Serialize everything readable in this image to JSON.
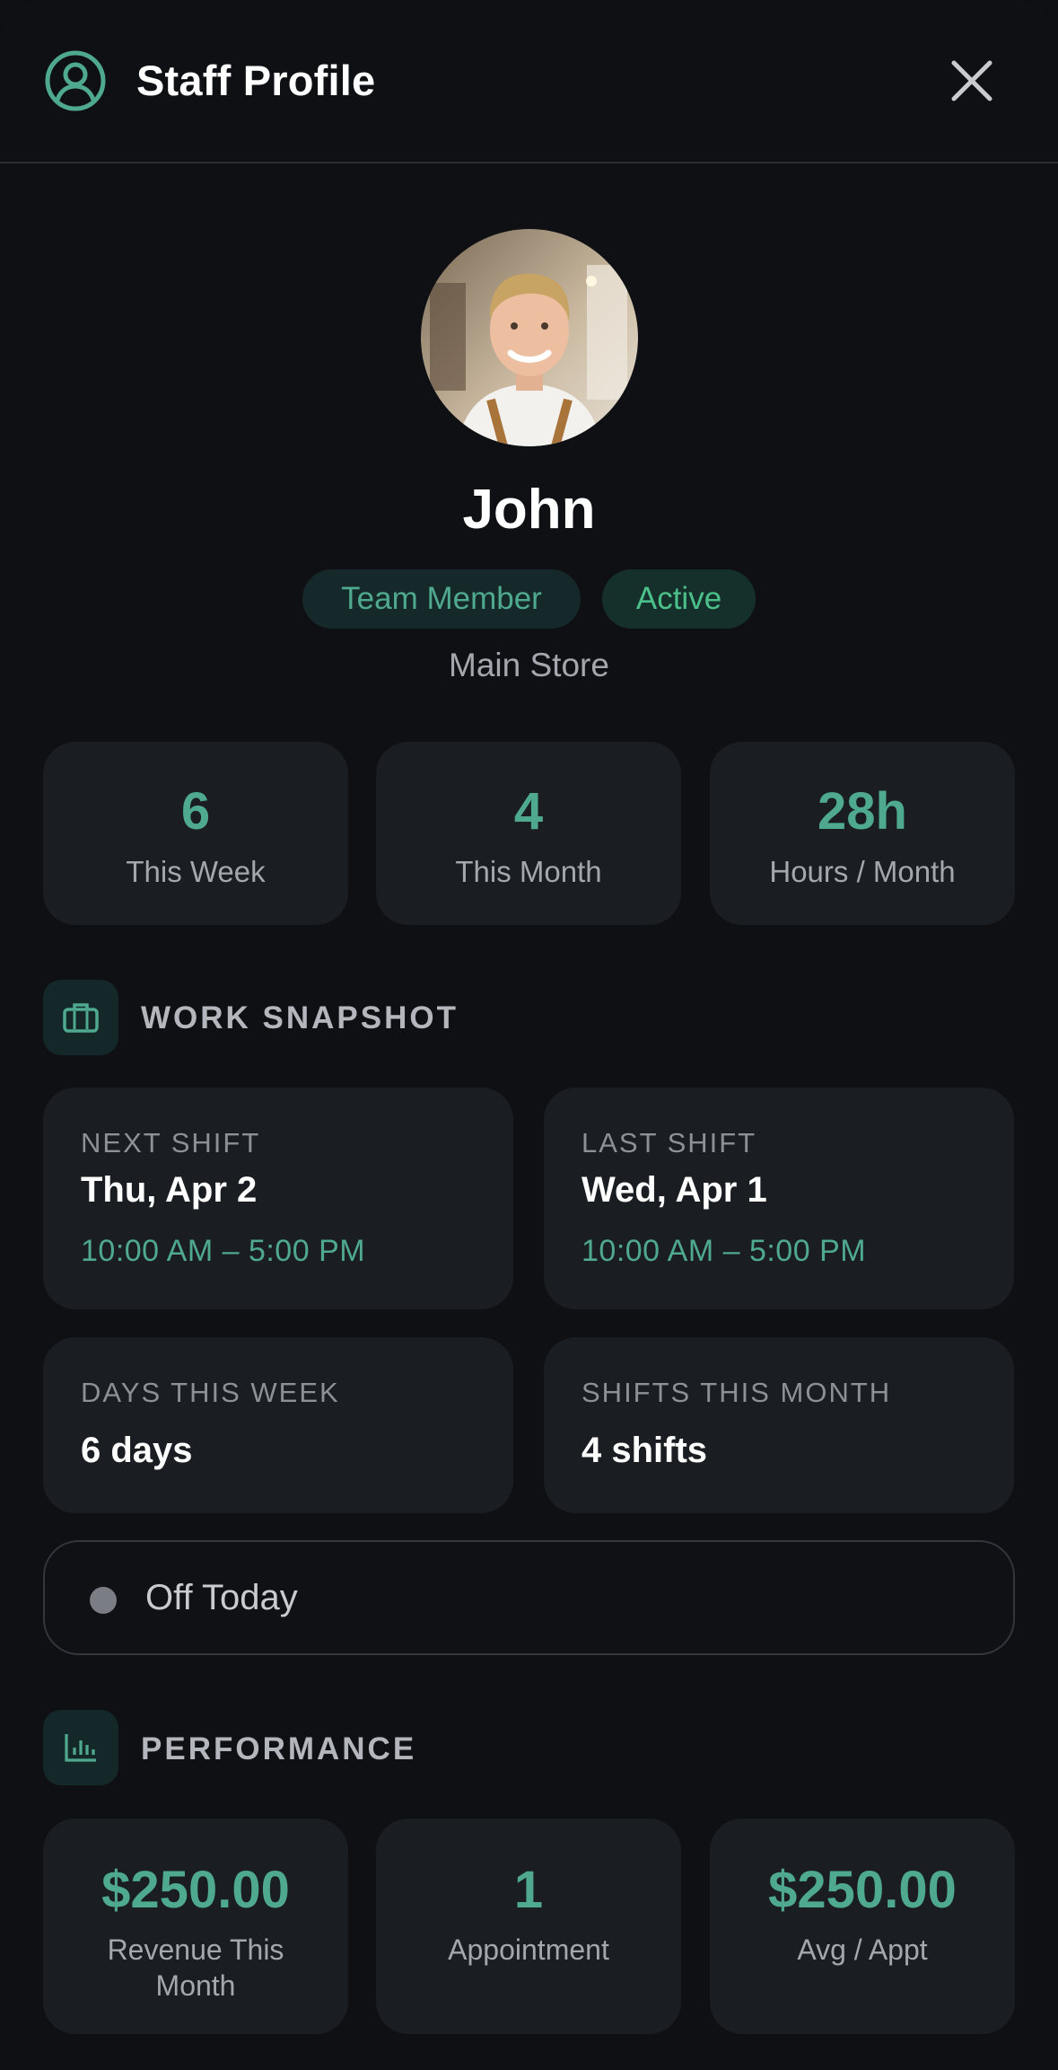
{
  "header": {
    "title": "Staff Profile",
    "icon": "user-circle-icon",
    "close_icon": "close-icon"
  },
  "profile": {
    "name": "John",
    "role_badge": "Team Member",
    "status_badge": "Active",
    "location": "Main Store"
  },
  "stats": [
    {
      "value": "6",
      "label": "This Week"
    },
    {
      "value": "4",
      "label": "This Month"
    },
    {
      "value": "28h",
      "label": "Hours / Month"
    }
  ],
  "work_snapshot": {
    "title": "WORK SNAPSHOT",
    "icon": "briefcase-icon",
    "next_shift": {
      "label": "NEXT SHIFT",
      "date": "Thu, Apr 2",
      "time": "10:00 AM – 5:00 PM"
    },
    "last_shift": {
      "label": "LAST SHIFT",
      "date": "Wed, Apr 1",
      "time": "10:00 AM – 5:00 PM"
    },
    "days_this_week": {
      "label": "DAYS THIS WEEK",
      "value": "6 days"
    },
    "shifts_this_month": {
      "label": "SHIFTS THIS MONTH",
      "value": "4 shifts"
    },
    "today_status": "Off Today"
  },
  "performance": {
    "title": "PERFORMANCE",
    "icon": "bar-chart-icon",
    "cards": [
      {
        "value": "$250.00",
        "label": "Revenue This Month"
      },
      {
        "value": "1",
        "label": "Appointment"
      },
      {
        "value": "$250.00",
        "label": "Avg / Appt"
      }
    ]
  },
  "colors": {
    "accent": "#4fa98f",
    "active": "#4cc08a",
    "background": "#0f1014",
    "card": "#1a1e22"
  }
}
